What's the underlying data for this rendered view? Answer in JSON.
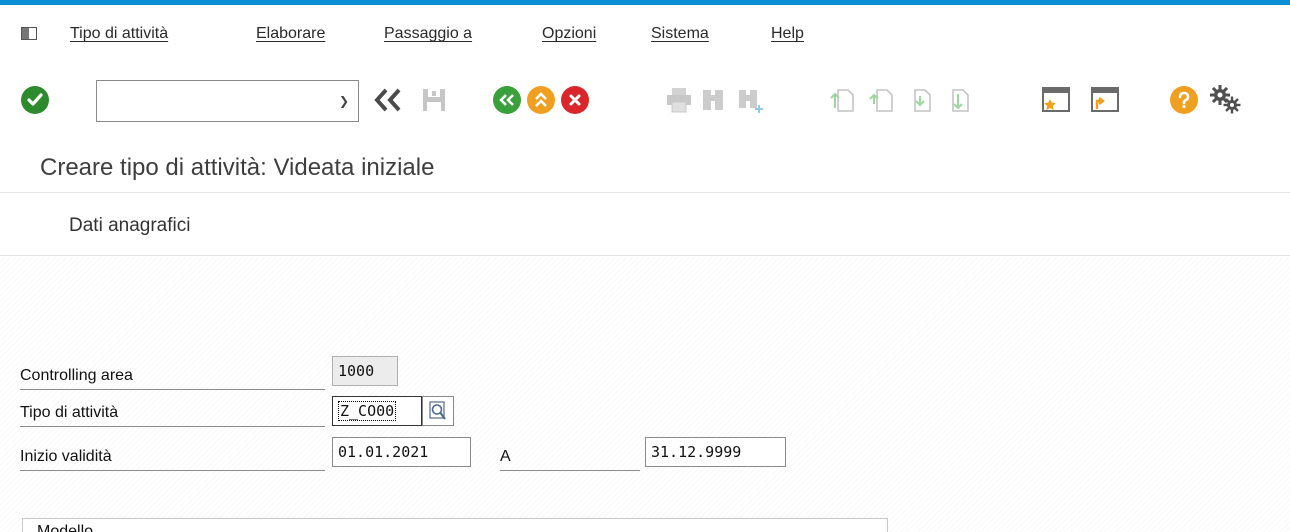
{
  "menubar": {
    "items": [
      {
        "label": "Tipo di attività"
      },
      {
        "label": "Elaborare"
      },
      {
        "label": "Passaggio a"
      },
      {
        "label": "Opzioni"
      },
      {
        "label": "Sistema"
      },
      {
        "label": "Help"
      }
    ]
  },
  "toolbar": {
    "command_field_value": "",
    "icons": [
      "check-icon",
      "back-double-icon",
      "save-icon",
      "back-icon",
      "exit-icon",
      "cancel-icon",
      "print-icon",
      "find-icon",
      "find-next-icon",
      "first-page-icon",
      "previous-page-icon",
      "next-page-icon",
      "last-page-icon",
      "new-session-icon",
      "create-shortcut-icon",
      "help-icon",
      "settings-icon"
    ]
  },
  "title": "Creare tipo di attività: Videata iniziale",
  "subtoolbar": {
    "button_label": "Dati anagrafici"
  },
  "form": {
    "controlling_area": {
      "label": "Controlling area",
      "value": "1000"
    },
    "tipo_attivita": {
      "label": "Tipo di attività",
      "value": "Z_CO00"
    },
    "inizio_validita": {
      "label": "Inizio validità",
      "value": "01.01.2021"
    },
    "a": {
      "label": "A",
      "value": "31.12.9999"
    }
  },
  "group": {
    "title": "Modello"
  },
  "colors": {
    "top_border": "#0a8fd4",
    "ok_green": "#2d8a2d",
    "back_green": "#3aa03a",
    "exit_orange": "#f0a020",
    "cancel_red": "#d8262c",
    "help_orange": "#f0a020"
  }
}
